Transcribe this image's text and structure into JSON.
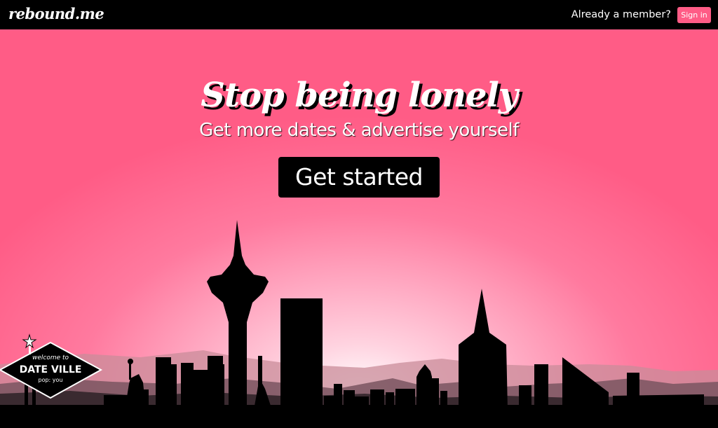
{
  "header": {
    "logo": "rebound.me",
    "member_prompt": "Already a member?",
    "signin_label": "Sign in"
  },
  "hero": {
    "headline": "Stop being lonely",
    "subline": "Get more dates & advertise yourself",
    "cta_label": "Get started"
  },
  "sign": {
    "welcome": "welcome to",
    "title": "DATE VILLE",
    "pop": "pop: you"
  },
  "colors": {
    "accent": "#ff5c86",
    "bar": "#000000",
    "text": "#ffffff"
  }
}
